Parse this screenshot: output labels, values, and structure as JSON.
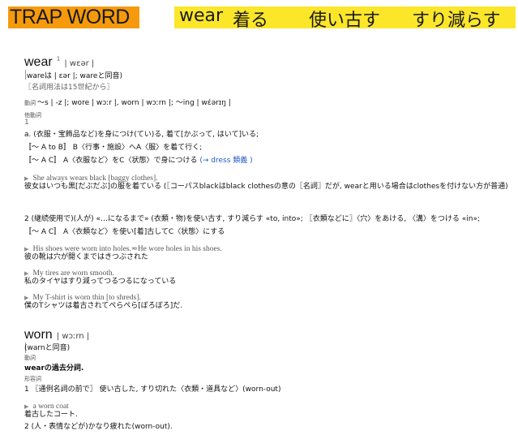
{
  "header": {
    "trap_word": "TRAP WORD",
    "terms": [
      "wear",
      "着る",
      "使い古す",
      "すり減らす"
    ]
  },
  "entry_wear": {
    "headword": "wear",
    "sup": "1",
    "pron": "| wɛər |",
    "homophone_note": "wareは | ɛər |; wareと同音)",
    "usage_note": "〖名詞用法は15世紀から〗",
    "forms_label": "動詞",
    "forms": "〜s | -z |; wore | wɔːr |, worn | wɔːrn |; 〜ing | wέərɪŋ |",
    "pos_label": "他動詞",
    "sense1_num": "1",
    "sense1a": "a. (衣服・宝飾品など)を身につけ(てい)る, 着て[かぶって, はいて]いる;",
    "sense1_pattern1": "〚〜 A to B〛 B〈行事・施設〉へA〈服〉を着て行く;",
    "sense1_pattern2": "〚〜 A C〛 A〈衣服など〉をC〈状態〉で身につける",
    "sense1_link": "(→ dress 類義 )",
    "sense1_example": "She always wears black [baggy clothes].",
    "sense1_translation": "彼女はいつも黒[だぶだぶ]の服を着ている (〖コーパスblackはblack clothesの意の〖名詞〗だが, wearと用いる場合はclothesを付けない方が普通)",
    "sense2": "2 (継続使用で)(人が) «…になるまで» (衣類・物)を使い古す, すり減らす «to, into»; 〖衣類などに〗〈穴〉をあける, 〈溝〉をつける «in»;",
    "sense2_pattern": "〚〜 A C〛 A〈衣類など〉を使い[着]古してC〈状態〉にする",
    "ex1": "His shoes were worn into holes.≂He wore holes in his shoes.",
    "tr1": "彼の靴は穴が開くまではきつぶされた",
    "ex2": "My tires are worn smooth.",
    "tr2": "私のタイヤはすり減ってつるつるになっている",
    "ex3": "My T-shirt is worn thin [to shreds].",
    "tr3": "僕のTシャツは着古されてぺらぺら[ぼろぼろ]だ."
  },
  "entry_worn": {
    "headword": "worn",
    "pron": "| wɔːrn |",
    "homophone_note": "(warnと同音)",
    "verb_label": "動詞",
    "verb_def": "wearの過去分詞.",
    "adj_label": "形容詞",
    "sense1": "1 〖通例名詞の前で〗 使い古した, すり切れた〈衣類・道具など〉(worn-out)",
    "ex1": "a worn coat",
    "tr1": "着古したコート.",
    "sense2": "2 (人・表情などが)かなり疲れた(worn-out)."
  }
}
